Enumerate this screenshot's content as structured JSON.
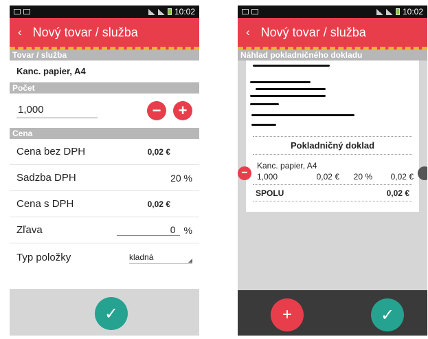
{
  "status": {
    "time": "10:02"
  },
  "left": {
    "appbar": {
      "back_icon": "‹",
      "title": "Nový tovar / služba"
    },
    "sections": {
      "item": "Tovar / služba",
      "count": "Počet",
      "price": "Cena"
    },
    "item_name": "Kanc. papier, A4",
    "quantity": "1,000",
    "fields": {
      "price_no_vat_label": "Cena bez DPH",
      "price_no_vat_value": "0,02 €",
      "vat_rate_label": "Sadzba DPH",
      "vat_rate_value": "20 %",
      "price_vat_label": "Cena s DPH",
      "price_vat_value": "0,02 €",
      "discount_label": "Zľava",
      "discount_value": "0",
      "discount_unit": "%",
      "item_type_label": "Typ položky",
      "item_type_value": "kladná"
    },
    "buttons": {
      "minus": "−",
      "plus": "+",
      "ok": "✓"
    }
  },
  "right": {
    "appbar": {
      "back_icon": "‹",
      "title": "Nový tovar / služba"
    },
    "section": "Náhlad pokladničného dokladu",
    "receipt": {
      "title": "Pokladničný doklad",
      "item_name": "Kanc. papier, A4",
      "qty": "1,000",
      "unit_price": "0,02 €",
      "vat": "20 %",
      "total": "0,02 €",
      "sum_label": "SPOLU",
      "sum_value": "0,02 €"
    },
    "buttons": {
      "remove": "−",
      "add": "+",
      "ok": "✓"
    }
  },
  "colors": {
    "accent": "#e83e4c",
    "ok": "#25a290",
    "section": "#b7b7b7"
  }
}
